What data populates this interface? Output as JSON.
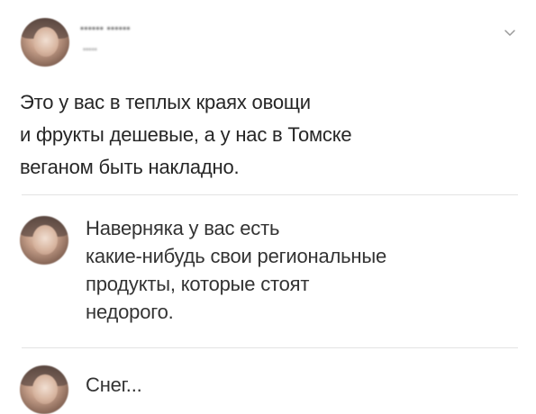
{
  "post": {
    "author_name": "•••••• ••••••",
    "author_subline": "•••••",
    "text": "Это у вас в теплых краях овощи\nи фрукты дешевые, а у нас в Томске\nвеганом быть накладно."
  },
  "replies": [
    {
      "text": "Наверняка у вас есть\nкакие-нибудь свои региональные\nпродукты, которые стоят\nнедорого."
    },
    {
      "text": "Снег..."
    }
  ],
  "icons": {
    "menu": "chevron-down-icon"
  },
  "colors": {
    "text": "#262626",
    "divider": "#e3e3e3",
    "background": "#ffffff"
  }
}
